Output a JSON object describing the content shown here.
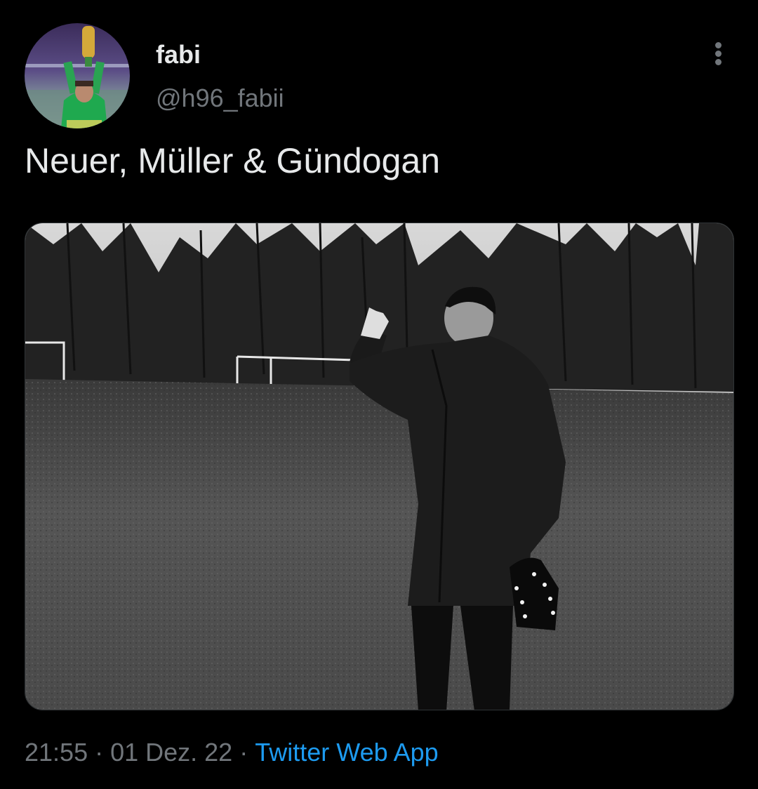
{
  "tweet": {
    "author": {
      "display_name": "fabi",
      "handle": "@h96_fabii"
    },
    "text": "Neuer, Müller & Gündogan",
    "meta": {
      "time": "21:55",
      "separator": "·",
      "date": "01 Dez. 22",
      "source": "Twitter Web App"
    },
    "icons": {
      "more": "more-options-icon"
    }
  },
  "colors": {
    "background": "#000000",
    "primary_text": "#e7e9ea",
    "secondary_text": "#71767b",
    "link": "#1d9bf0"
  }
}
